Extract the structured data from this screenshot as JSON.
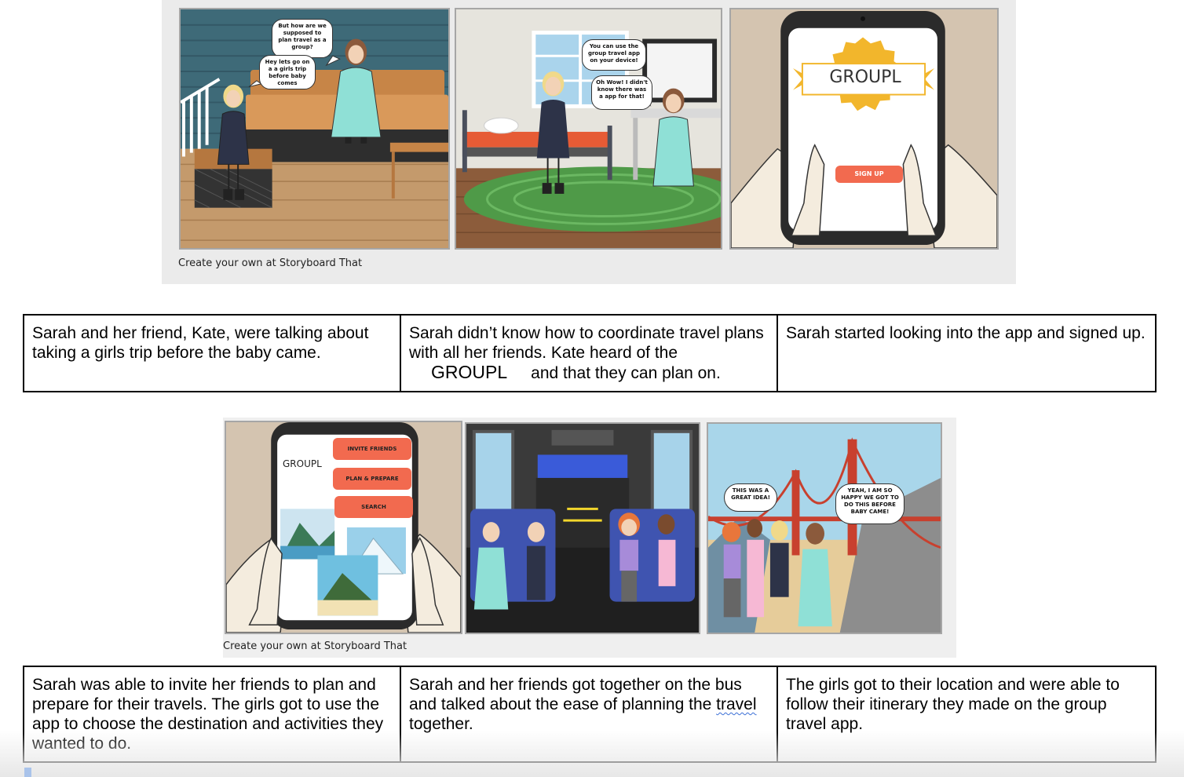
{
  "storyboard_top": {
    "credit": "Create your own at Storyboard That",
    "panel1": {
      "bubble_top": "But how are we supposed to plan travel as a group?",
      "bubble_left": "Hey lets go on a a girls trip before baby comes"
    },
    "panel2": {
      "bubble_top": "You can use the group travel app on your device!",
      "bubble_bottom": "Oh Wow! I didn't know there was a app for that!"
    },
    "panel3": {
      "logo": "GROUPL",
      "button": "SIGN UP"
    }
  },
  "captions_top": {
    "cell1": "Sarah and her friend, Kate, were talking about taking a girls trip before the baby came.",
    "cell2_line1": "Sarah didn’t know how to coordinate travel plans with all her friends. Kate heard of the",
    "cell2_logo": "GROUPL",
    "cell2_line2": "and that they can plan on.",
    "cell3": "Sarah started looking into the app and signed up."
  },
  "storyboard_bottom": {
    "credit": "Create your own at Storyboard That",
    "panel1": {
      "logo": "GROUPL",
      "buttons": [
        "INVITE  FRIENDS",
        "PLAN & PREPARE",
        "SEARCH"
      ]
    },
    "panel3": {
      "bubble_left": "THIS WAS A GREAT IDEA!",
      "bubble_right": "YEAH, I AM SO HAPPY WE GOT TO DO THIS BEFORE BABY CAME!"
    }
  },
  "captions_bottom": {
    "cell1": "Sarah was able to invite her friends to plan and prepare for their travels. The girls got to use the app to choose the destination and activities they wanted to do.",
    "cell2_before": "Sarah and her friends got together on the bus and talked about the ease of planning the ",
    "cell2_flagged": "travel",
    "cell2_after": " together.",
    "cell3": "The girls got to their location and were able to follow their itinerary they made on the group travel app."
  }
}
